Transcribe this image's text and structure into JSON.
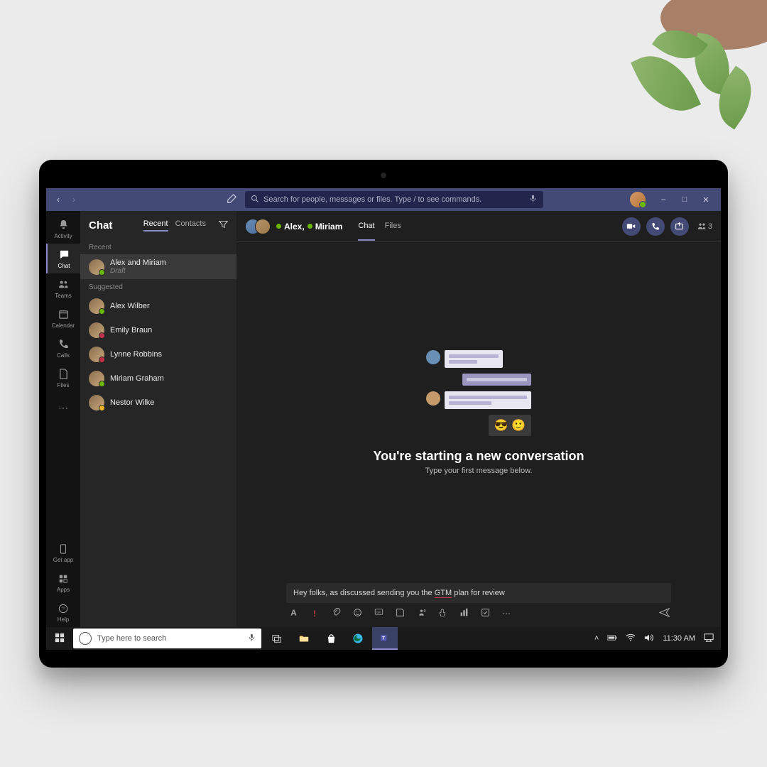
{
  "titlebar": {
    "search_placeholder": "Search for people, messages or files. Type / to see commands."
  },
  "rail": {
    "items": [
      {
        "label": "Activity",
        "icon": "bell-icon"
      },
      {
        "label": "Chat",
        "icon": "chat-icon",
        "active": true
      },
      {
        "label": "Teams",
        "icon": "teams-icon"
      },
      {
        "label": "Calendar",
        "icon": "calendar-icon"
      },
      {
        "label": "Calls",
        "icon": "phone-icon"
      },
      {
        "label": "Files",
        "icon": "file-icon"
      }
    ],
    "bottom": [
      {
        "label": "Get app",
        "icon": "mobile-icon"
      },
      {
        "label": "Apps",
        "icon": "apps-icon"
      },
      {
        "label": "Help",
        "icon": "help-icon"
      }
    ]
  },
  "chat_panel": {
    "title": "Chat",
    "tabs": {
      "recent": "Recent",
      "contacts": "Contacts"
    },
    "sections": {
      "recent": {
        "label": "Recent",
        "items": [
          {
            "name": "Alex and Miriam",
            "sub": "Draft",
            "status": "g",
            "selected": true
          }
        ]
      },
      "suggested": {
        "label": "Suggested",
        "items": [
          {
            "name": "Alex Wilber",
            "status": "g"
          },
          {
            "name": "Emily Braun",
            "status": "r"
          },
          {
            "name": "Lynne Robbins",
            "status": "r"
          },
          {
            "name": "Miriam Graham",
            "status": "g"
          },
          {
            "name": "Nestor Wilke",
            "status": "y"
          }
        ]
      }
    }
  },
  "chat_header": {
    "name1": "Alex,",
    "name2": "Miriam",
    "tabs": {
      "chat": "Chat",
      "files": "Files"
    },
    "participants": "3"
  },
  "conversation": {
    "headline": "You're starting a new conversation",
    "subline": "Type your first message below.",
    "emoji1": "😎",
    "emoji2": "🙂"
  },
  "composer": {
    "text_pre": "Hey folks, as discussed sending you the ",
    "text_uword": "GTM",
    "text_post": " plan for review"
  },
  "taskbar": {
    "search_placeholder": "Type here to search",
    "time": "11:30 AM"
  }
}
